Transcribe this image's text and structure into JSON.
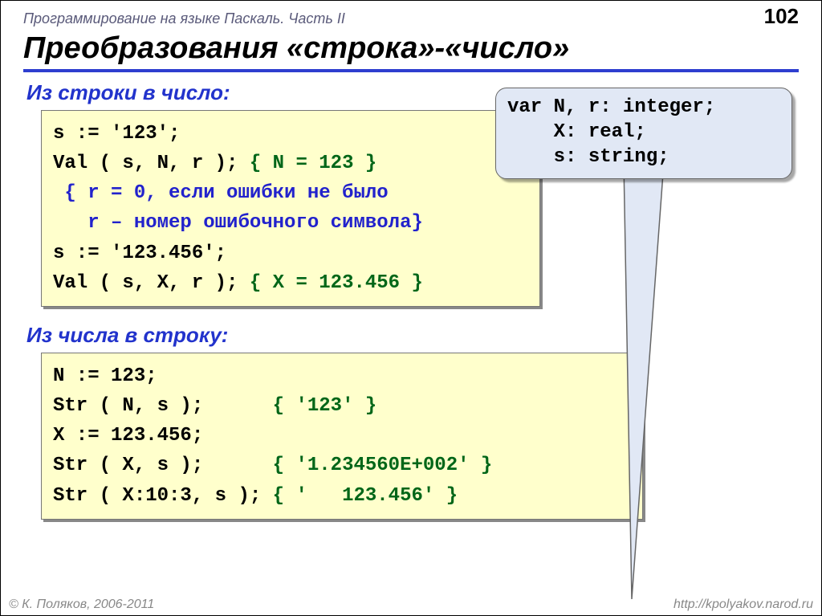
{
  "header": {
    "course": "Программирование на языке Паскаль. Часть II",
    "page_number": "102"
  },
  "title": "Преобразования «строка»-«число»",
  "section1_title": "Из строки в число:",
  "code1": {
    "l1": "s := '123';",
    "l2a": "Val ( s, N, r ); ",
    "l2b": "{ N = 123 }",
    "l3": " { r = 0, если ошибки не было",
    "l4": "   r – номер ошибочного символа}",
    "l5": "s := '123.456';",
    "l6a": "Val ( s, X, r ); ",
    "l6b": "{ X = 123.456 }"
  },
  "section2_title": "Из числа в строку:",
  "code2": {
    "l1": "N := 123;",
    "l2a": "Str ( N, s );      ",
    "l2b": "{ '123' }",
    "l3": "X := 123.456;",
    "l4a": "Str ( X, s );      ",
    "l4b": "{ '1.234560E+002' }",
    "l5a": "Str ( X:10:3, s ); ",
    "l5b": "{ '   123.456' }"
  },
  "callout": {
    "l1": "var N, r: integer;",
    "l2": "    X: real;",
    "l3": "    s: string;"
  },
  "footer": {
    "copyright": "© К. Поляков, 2006-2011",
    "url": "http://kpolyakov.narod.ru"
  }
}
